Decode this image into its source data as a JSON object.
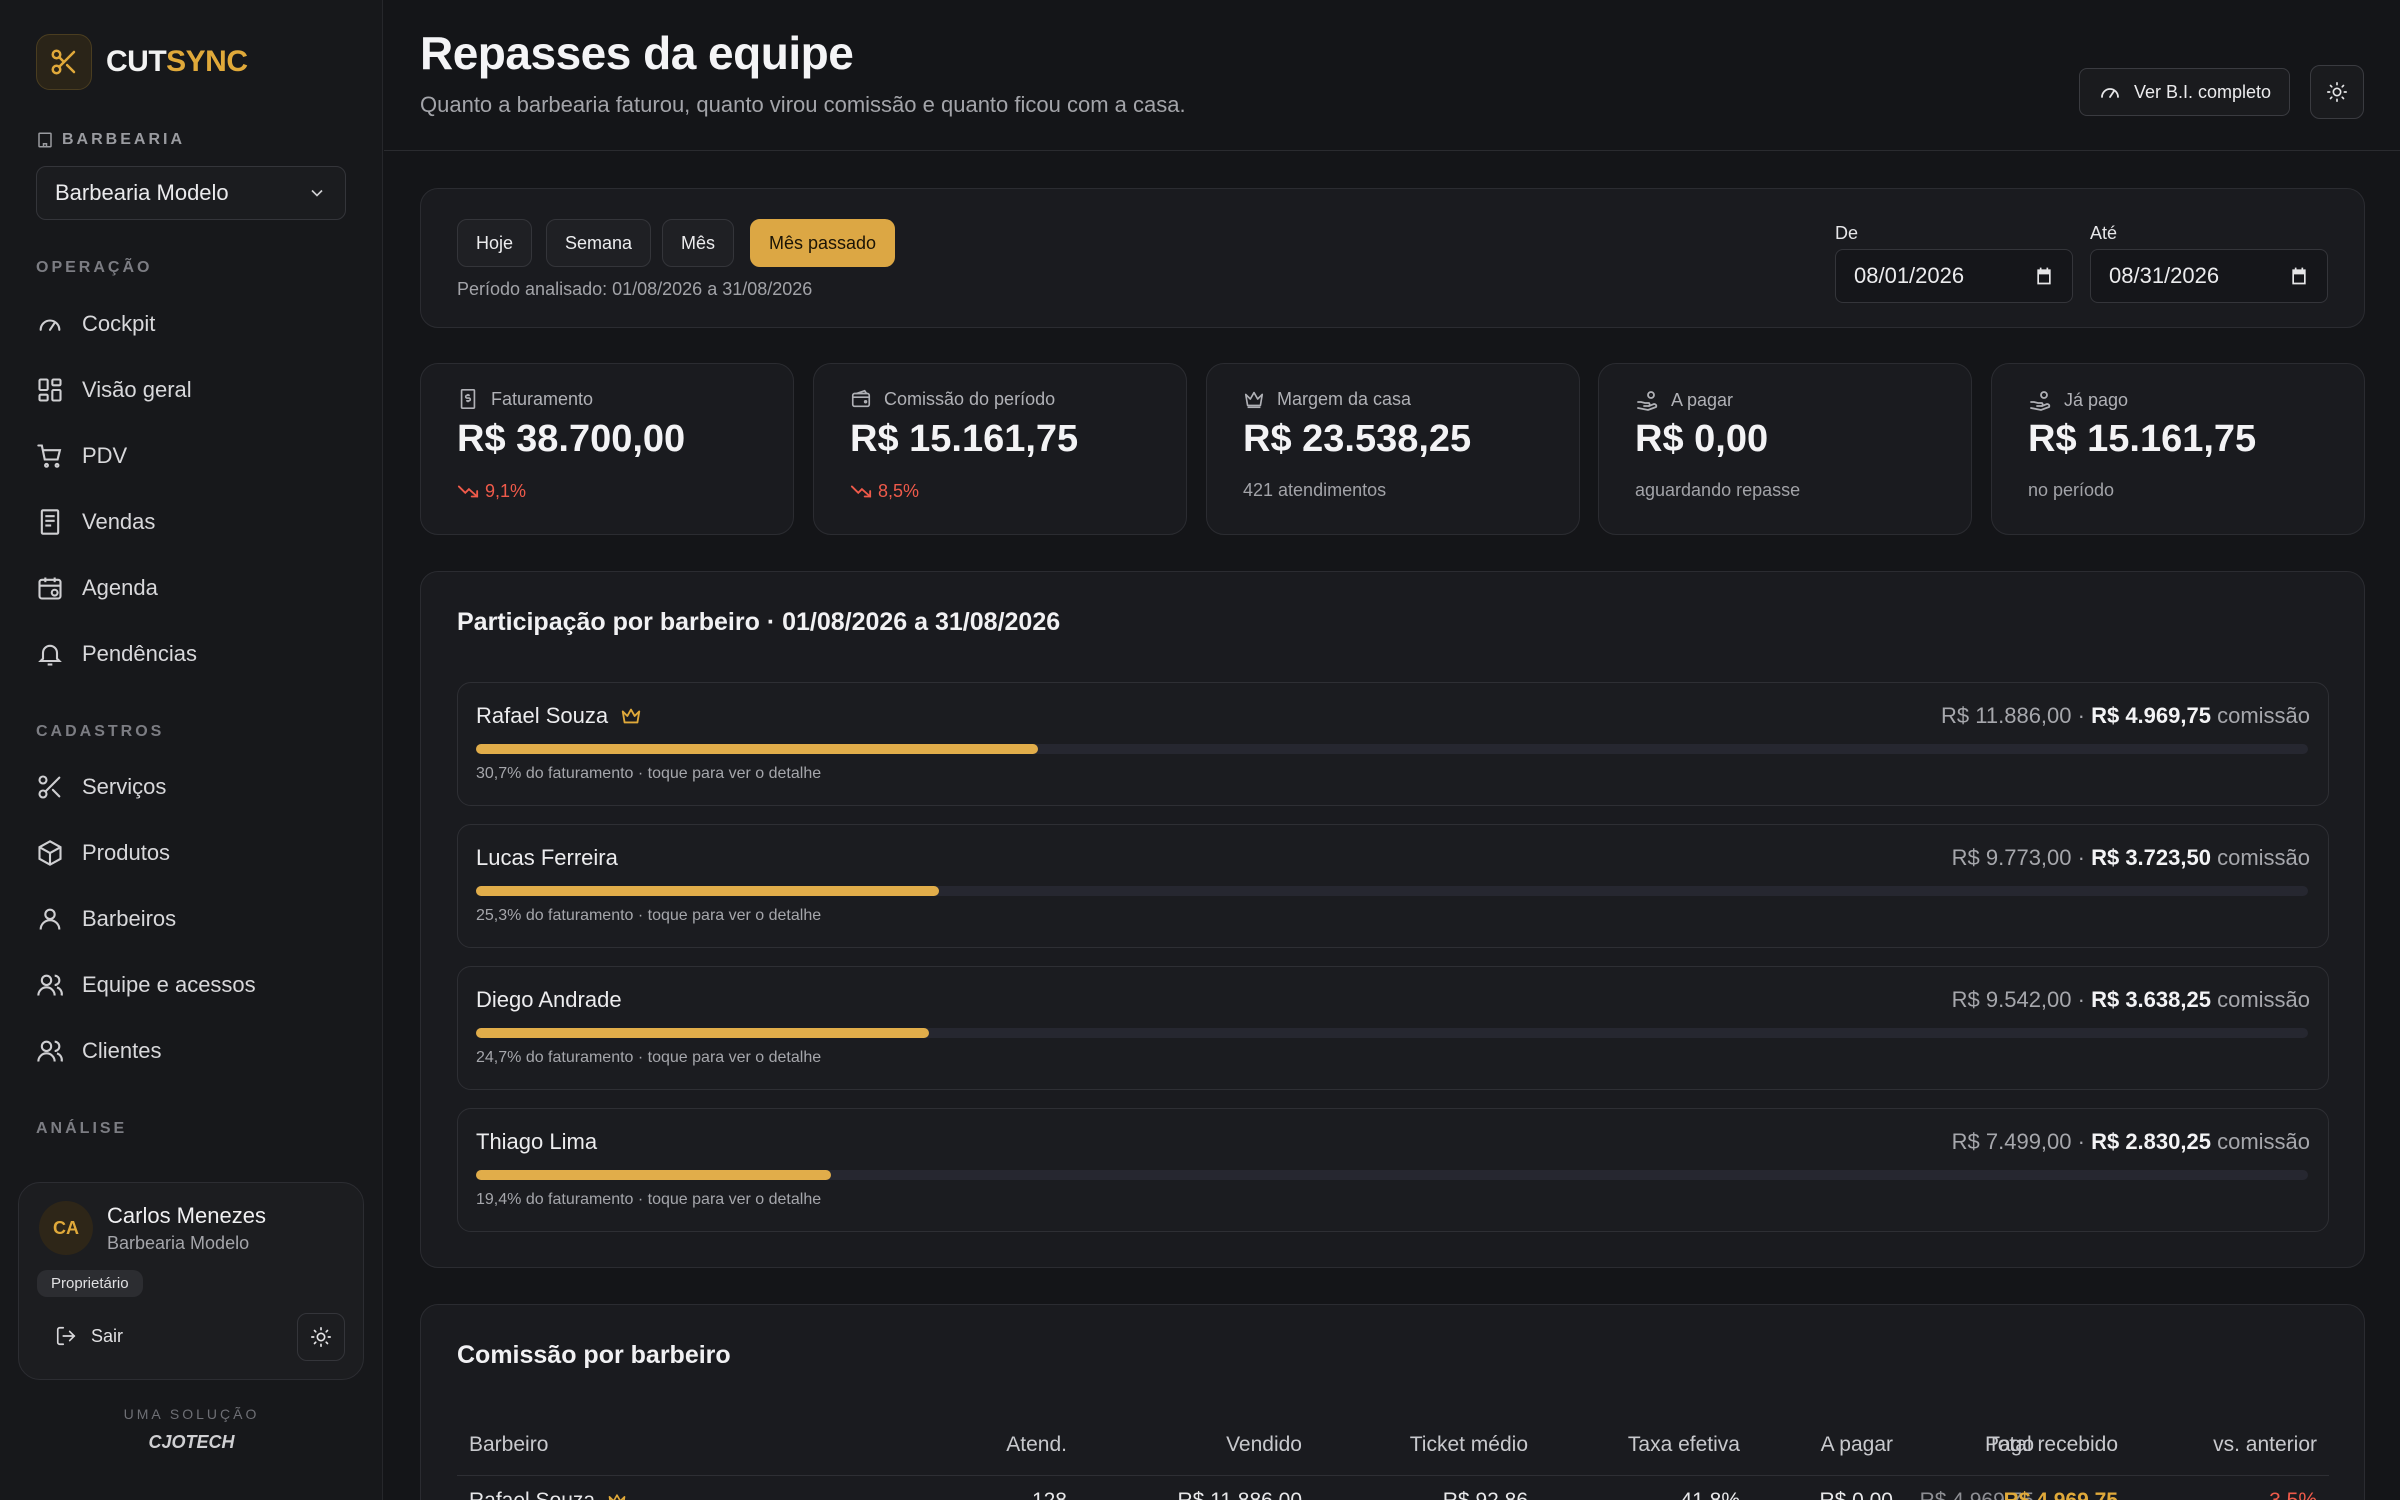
{
  "brand": {
    "name_a": "CUT",
    "name_b": "SYNC"
  },
  "sidebar": {
    "shop_label": "BARBEARIA",
    "shop_selected": "Barbearia Modelo",
    "sections": {
      "operacao": "OPERAÇÃO",
      "cadastros": "CADASTROS",
      "analise": "ANÁLISE"
    },
    "operacao": [
      {
        "label": "Cockpit",
        "icon": "gauge-icon"
      },
      {
        "label": "Visão geral",
        "icon": "grid-icon"
      },
      {
        "label": "PDV",
        "icon": "cart-icon"
      },
      {
        "label": "Vendas",
        "icon": "receipt-icon"
      },
      {
        "label": "Agenda",
        "icon": "calendar-icon"
      },
      {
        "label": "Pendências",
        "icon": "bell-icon"
      }
    ],
    "cadastros": [
      {
        "label": "Serviços",
        "icon": "scissors-icon"
      },
      {
        "label": "Produtos",
        "icon": "box-icon"
      },
      {
        "label": "Barbeiros",
        "icon": "user-icon"
      },
      {
        "label": "Equipe e acessos",
        "icon": "users-icon"
      },
      {
        "label": "Clientes",
        "icon": "clients-icon"
      }
    ],
    "user": {
      "initials": "CA",
      "name": "Carlos Menezes",
      "shop": "Barbearia Modelo",
      "role": "Proprietário",
      "logout": "Sair"
    },
    "solution_label": "UMA SOLUÇÃO",
    "solution_brand": "CJOTECH"
  },
  "header": {
    "title": "Repasses da equipe",
    "subtitle": "Quanto a barbearia faturou, quanto virou comissão e quanto ficou com a casa.",
    "bi_button": "Ver B.I. completo"
  },
  "filters": {
    "ranges": [
      "Hoje",
      "Semana",
      "Mês",
      "Mês passado"
    ],
    "active": "Mês passado",
    "period_text": "Período analisado: 01/08/2026 a 31/08/2026",
    "from_label": "De",
    "from_value": "08/01/2026",
    "to_label": "Até",
    "to_value": "08/31/2026"
  },
  "kpis": [
    {
      "label": "Faturamento",
      "value": "R$ 38.700,00",
      "foot": "9,1%",
      "trend": "down",
      "icon": "invoice-icon"
    },
    {
      "label": "Comissão do período",
      "value": "R$ 15.161,75",
      "foot": "8,5%",
      "trend": "down",
      "icon": "wallet-icon"
    },
    {
      "label": "Margem da casa",
      "value": "R$ 23.538,25",
      "foot": "421 atendimentos",
      "trend": "none",
      "icon": "crown-icon"
    },
    {
      "label": "A pagar",
      "value": "R$ 0,00",
      "foot": "aguardando repasse",
      "trend": "none",
      "icon": "hand-coins-icon"
    },
    {
      "label": "Já pago",
      "value": "R$ 15.161,75",
      "foot": "no período",
      "trend": "none",
      "icon": "hand-coins-icon"
    }
  ],
  "share": {
    "title": "Participação por barbeiro · 01/08/2026 a 31/08/2026",
    "rows": [
      {
        "name": "Rafael Souza",
        "top": true,
        "sold": "R$ 11.886,00",
        "commission": "R$ 4.969,75",
        "commission_word": "comissão",
        "note": "30,7% do faturamento · toque para ver o detalhe",
        "share": 0.307
      },
      {
        "name": "Lucas Ferreira",
        "top": false,
        "sold": "R$ 9.773,00",
        "commission": "R$ 3.723,50",
        "commission_word": "comissão",
        "note": "25,3% do faturamento · toque para ver o detalhe",
        "share": 0.253
      },
      {
        "name": "Diego Andrade",
        "top": false,
        "sold": "R$ 9.542,00",
        "commission": "R$ 3.638,25",
        "commission_word": "comissão",
        "note": "24,7% do faturamento · toque para ver o detalhe",
        "share": 0.247
      },
      {
        "name": "Thiago Lima",
        "top": false,
        "sold": "R$ 7.499,00",
        "commission": "R$ 2.830,25",
        "commission_word": "comissão",
        "note": "19,4% do faturamento · toque para ver o detalhe",
        "share": 0.194
      }
    ]
  },
  "table": {
    "title": "Comissão por barbeiro",
    "headers": [
      "Barbeiro",
      "Atend.",
      "Vendido",
      "Ticket médio",
      "Taxa efetiva",
      "A pagar",
      "Pago",
      "Total recebido",
      "vs. anterior"
    ],
    "first_row": [
      "Rafael Souza",
      "128",
      "R$ 11.886,00",
      "R$ 92,86",
      "41,8%",
      "R$ 0,00",
      "R$ 4.969,75",
      "R$ 4.969,75",
      "3,5%"
    ]
  },
  "colors": {
    "accent": "#dca744",
    "negative": "#ef5a4a",
    "background": "#141518"
  }
}
